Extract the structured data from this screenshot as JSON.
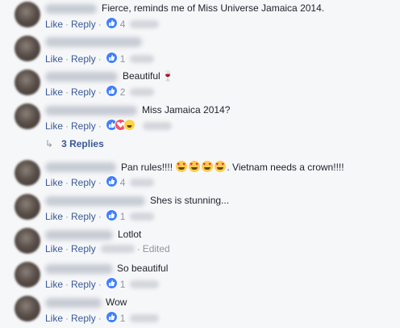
{
  "actions": {
    "like_label": "Like",
    "reply_label": "Reply",
    "separator": "·",
    "edited_label": "Edited"
  },
  "comments": [
    {
      "text": "Fierce, reminds me of Miss Universe Jamaica 2014.",
      "likes": "4"
    },
    {
      "text": "",
      "likes": "1"
    },
    {
      "text": "Beautiful",
      "likes": "2"
    },
    {
      "text": "Miss Jamaica 2014?",
      "likes": ""
    },
    {
      "text_before": "Pan rules!!!!",
      "text_after": ". Vietnam needs a crown!!!!",
      "likes": "4"
    },
    {
      "text": "Shes is stunning...",
      "likes": "1"
    },
    {
      "text": "Lotlot",
      "likes": ""
    },
    {
      "text": "So beautiful",
      "likes": "1"
    },
    {
      "text": "Wow",
      "likes": "1"
    }
  ],
  "replies_link": "3 Replies",
  "colors": {
    "link": "#385898",
    "like_blue": "#4080ff",
    "love_red": "#f25268",
    "background": "#f6f7f9"
  }
}
